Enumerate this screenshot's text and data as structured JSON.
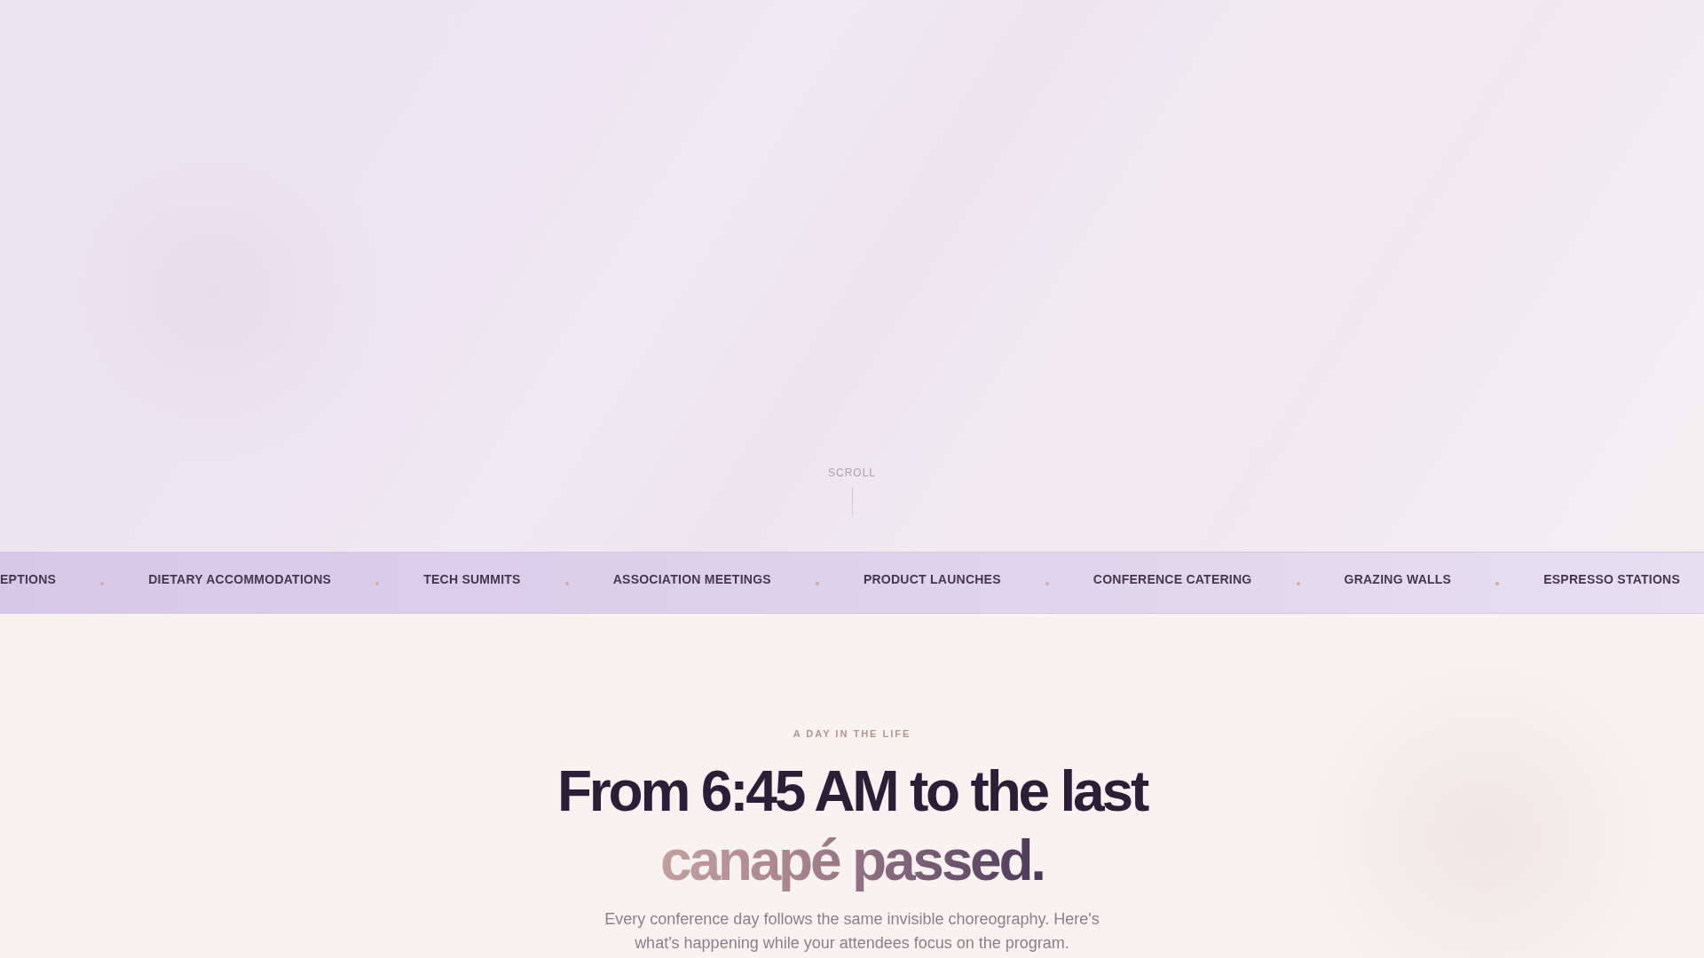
{
  "hero": {
    "scroll_hint": "SCROLL"
  },
  "marquee": {
    "items": [
      "EPTIONS",
      "DIETARY ACCOMMODATIONS",
      "TECH SUMMITS",
      "ASSOCIATION MEETINGS",
      "PRODUCT LAUNCHES",
      "CONFERENCE CATERING",
      "GRAZING WALLS",
      "ESPRESSO STATIONS"
    ]
  },
  "timeline_intro": {
    "eyebrow": "A DAY IN THE LIFE",
    "heading": "From 6:45 AM to the last",
    "heading_highlight": "canapé passed.",
    "description": "Every conference day follows the same invisible choreography. Here's what's happening while your attendees focus on the program."
  }
}
